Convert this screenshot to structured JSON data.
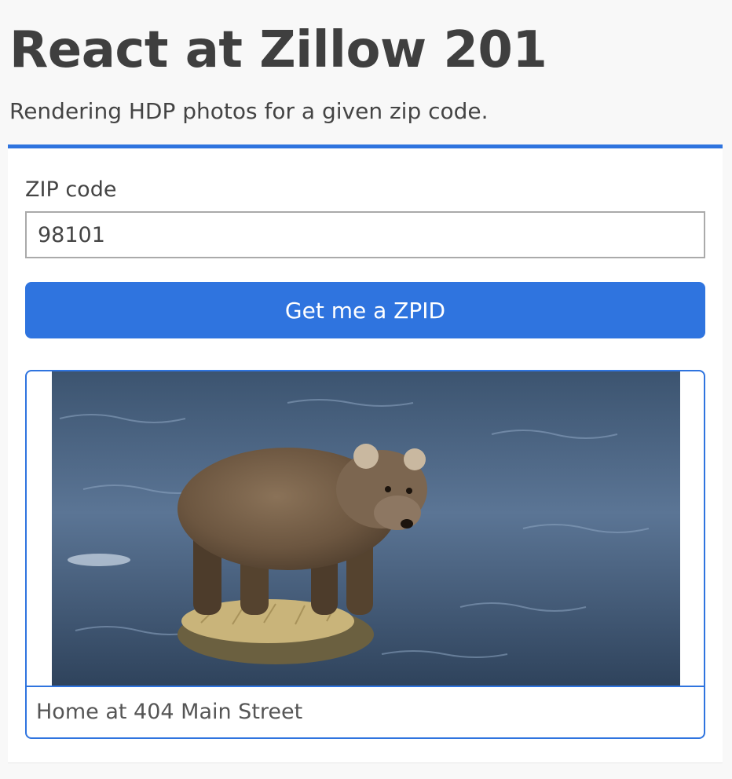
{
  "header": {
    "title": "React at Zillow 201",
    "subtitle": "Rendering HDP photos for a given zip code."
  },
  "form": {
    "zip_label": "ZIP code",
    "zip_value": "98101",
    "submit_label": "Get me a ZPID"
  },
  "listing": {
    "photo_icon": "bear-photo",
    "caption": "Home at 404 Main Street"
  },
  "colors": {
    "accent": "#2f74df",
    "background": "#f8f8f8",
    "card": "#ffffff",
    "text": "#444444"
  }
}
